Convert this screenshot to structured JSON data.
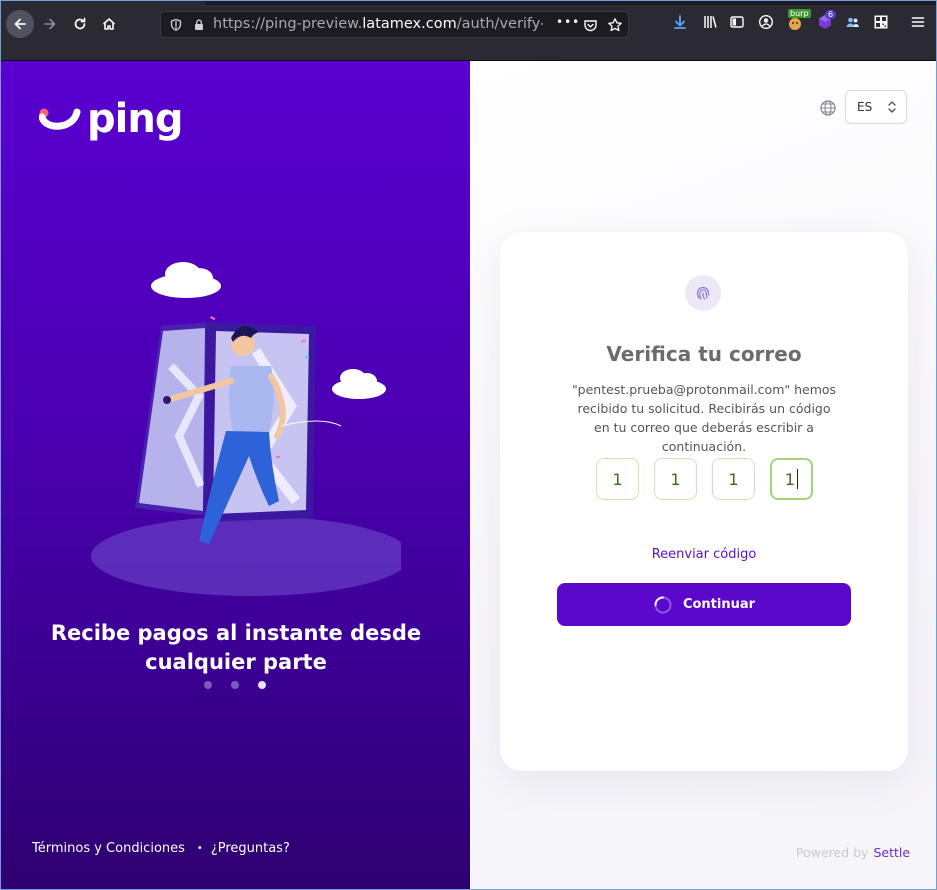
{
  "browser": {
    "url_prefix": "https://ping-preview.",
    "url_host": "latamex.com",
    "url_path": "/auth/verify-passwo",
    "more_glyph": "•••",
    "extension_badge_burp": "burp",
    "extension_badge_count": "6"
  },
  "left_panel": {
    "logo_text": "ping",
    "hero_title": "Recibe pagos al instante desde cualquier parte",
    "slides": [
      false,
      false,
      true
    ],
    "footer": {
      "terms": "Términos y Condiciones",
      "separator": "•",
      "questions": "¿Preguntas?"
    }
  },
  "right_panel": {
    "language": "ES",
    "card": {
      "title": "Verifica tu correo",
      "description": "\"pentest.prueba@protonmail.com\" hemos recibido tu solicitud. Recibirás un código en tu correo que deberás escribir a continuación.",
      "otp": [
        "1",
        "1",
        "1",
        "1"
      ],
      "resend_label": "Reenviar código",
      "continue_label": "Continuar"
    },
    "powered_by": "Powered by",
    "powered_brand": "Settle"
  },
  "colors": {
    "brand_purple": "#5b08cc",
    "otp_border": "#cbe4b4",
    "otp_text": "#3d6b1f",
    "chrome_bg": "#2b2a33"
  },
  "icons": [
    "back-arrow-icon",
    "forward-arrow-icon",
    "reload-icon",
    "home-icon",
    "shield-icon",
    "lock-icon",
    "pocket-icon",
    "bookmark-star-icon",
    "download-icon",
    "library-icon",
    "sidebar-icon",
    "account-icon",
    "menu-icon",
    "globe-icon",
    "chevron-updown-icon",
    "fingerprint-icon",
    "spinner-icon"
  ]
}
